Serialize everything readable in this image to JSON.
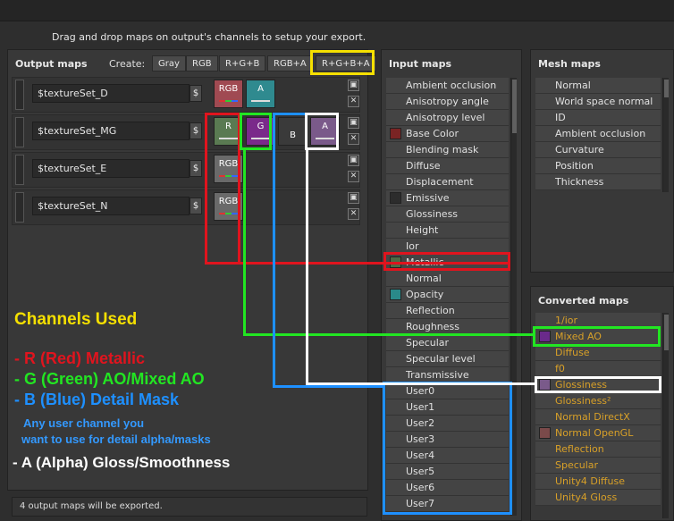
{
  "hint": "Drag and drop maps on output's channels to setup your export.",
  "output": {
    "title": "Output maps",
    "create_label": "Create:",
    "create_buttons": [
      "Gray",
      "RGB",
      "R+G+B",
      "RGB+A",
      "R+G+B+A"
    ],
    "rows": [
      {
        "name": "$textureSet_D",
        "channels": [
          "RGB",
          "A"
        ]
      },
      {
        "name": "$textureSet_MG",
        "channels": [
          "R",
          "G",
          "B",
          "A"
        ]
      },
      {
        "name": "$textureSet_E",
        "channels": [
          "RGB"
        ]
      },
      {
        "name": "$textureSet_N",
        "channels": [
          "RGB"
        ]
      }
    ],
    "dollar": "$",
    "footer": "4 output maps will be exported."
  },
  "annotations": {
    "title": "Channels Used",
    "r": "- R (Red) Metallic",
    "g": "- G (Green) AO/Mixed AO",
    "b": "- B (Blue) Detail Mask",
    "b_note1": "Any user channel you",
    "b_note2": "want to use for detail alpha/masks",
    "a": "- A (Alpha) Gloss/Smoothness"
  },
  "input": {
    "title": "Input maps",
    "items": [
      "Ambient occlusion",
      "Anisotropy angle",
      "Anisotropy level",
      "Base Color",
      "Blending mask",
      "Diffuse",
      "Displacement",
      "Emissive",
      "Glossiness",
      "Height",
      "Ior",
      "Metallic",
      "Normal",
      "Opacity",
      "Reflection",
      "Roughness",
      "Specular",
      "Specular level",
      "Transmissive",
      "User0",
      "User1",
      "User2",
      "User3",
      "User4",
      "User5",
      "User6",
      "User7"
    ]
  },
  "mesh": {
    "title": "Mesh maps",
    "items": [
      "Normal",
      "World space normal",
      "ID",
      "Ambient occlusion",
      "Curvature",
      "Position",
      "Thickness"
    ]
  },
  "converted": {
    "title": "Converted maps",
    "items": [
      "1/ior",
      "Mixed AO",
      "Diffuse",
      "f0",
      "Glossiness",
      "Glossiness²",
      "Normal DirectX",
      "Normal OpenGL",
      "Reflection",
      "Specular",
      "Unity4 Diffuse",
      "Unity4 Gloss"
    ]
  },
  "colors": {
    "red": "#e0141e",
    "green": "#22e622",
    "blue": "#1e90ff",
    "white": "#ffffff",
    "yellow": "#f5e000",
    "annot_title": "#f5e000",
    "annot_r": "#e0141e",
    "annot_g": "#22e622",
    "annot_b": "#1e90ff",
    "annot_a": "#ffffff"
  }
}
